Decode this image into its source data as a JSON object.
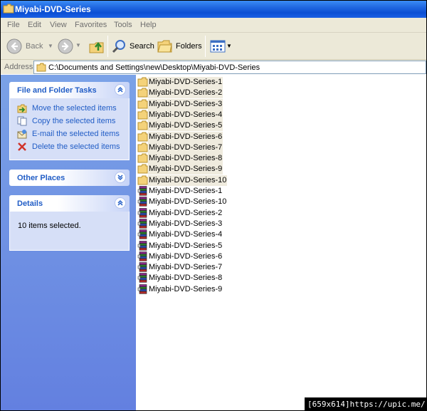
{
  "window": {
    "title": "Miyabi-DVD-Series"
  },
  "menu": [
    "File",
    "Edit",
    "View",
    "Favorites",
    "Tools",
    "Help"
  ],
  "toolbar": {
    "back_label": "Back",
    "search_label": "Search",
    "folders_label": "Folders",
    "icons": [
      "back-arrow-icon",
      "forward-arrow-icon",
      "up-folder-icon",
      "search-icon",
      "folders-icon",
      "views-icon"
    ]
  },
  "address": {
    "label": "Address",
    "value": "C:\\Documents and Settings\\new\\Desktop\\Miyabi-DVD-Series"
  },
  "tasks_panel": {
    "title": "File and Folder Tasks",
    "items": [
      {
        "label": "Move the selected items",
        "icon": "move-icon"
      },
      {
        "label": "Copy the selected items",
        "icon": "copy-icon"
      },
      {
        "label": "E-mail the selected items",
        "icon": "email-icon"
      },
      {
        "label": "Delete the selected items",
        "icon": "delete-x-icon"
      }
    ]
  },
  "other_places": {
    "title": "Other Places"
  },
  "details": {
    "title": "Details",
    "text": "10 items selected."
  },
  "files": [
    {
      "name": "Miyabi-DVD-Series-1",
      "type": "folder",
      "selected": true
    },
    {
      "name": "Miyabi-DVD-Series-2",
      "type": "folder",
      "selected": true
    },
    {
      "name": "Miyabi-DVD-Series-3",
      "type": "folder",
      "selected": true
    },
    {
      "name": "Miyabi-DVD-Series-4",
      "type": "folder",
      "selected": true
    },
    {
      "name": "Miyabi-DVD-Series-5",
      "type": "folder",
      "selected": true
    },
    {
      "name": "Miyabi-DVD-Series-6",
      "type": "folder",
      "selected": true
    },
    {
      "name": "Miyabi-DVD-Series-7",
      "type": "folder",
      "selected": true
    },
    {
      "name": "Miyabi-DVD-Series-8",
      "type": "folder",
      "selected": true
    },
    {
      "name": "Miyabi-DVD-Series-9",
      "type": "folder",
      "selected": true
    },
    {
      "name": "Miyabi-DVD-Series-10",
      "type": "folder",
      "selected": true
    },
    {
      "name": "Miyabi-DVD-Series-1",
      "type": "archive",
      "selected": false
    },
    {
      "name": "Miyabi-DVD-Series-10",
      "type": "archive",
      "selected": false
    },
    {
      "name": "Miyabi-DVD-Series-2",
      "type": "archive",
      "selected": false
    },
    {
      "name": "Miyabi-DVD-Series-3",
      "type": "archive",
      "selected": false
    },
    {
      "name": "Miyabi-DVD-Series-4",
      "type": "archive",
      "selected": false
    },
    {
      "name": "Miyabi-DVD-Series-5",
      "type": "archive",
      "selected": false
    },
    {
      "name": "Miyabi-DVD-Series-6",
      "type": "archive",
      "selected": false
    },
    {
      "name": "Miyabi-DVD-Series-7",
      "type": "archive",
      "selected": false
    },
    {
      "name": "Miyabi-DVD-Series-8",
      "type": "archive",
      "selected": false
    },
    {
      "name": "Miyabi-DVD-Series-9",
      "type": "archive",
      "selected": false
    }
  ],
  "watermark": "[659x614]https://upic.me/",
  "colors": {
    "titlebar": "#0b4fd4",
    "sidebar": "#6f91e4",
    "panel_link": "#215dc6",
    "selection": "#efebde"
  }
}
